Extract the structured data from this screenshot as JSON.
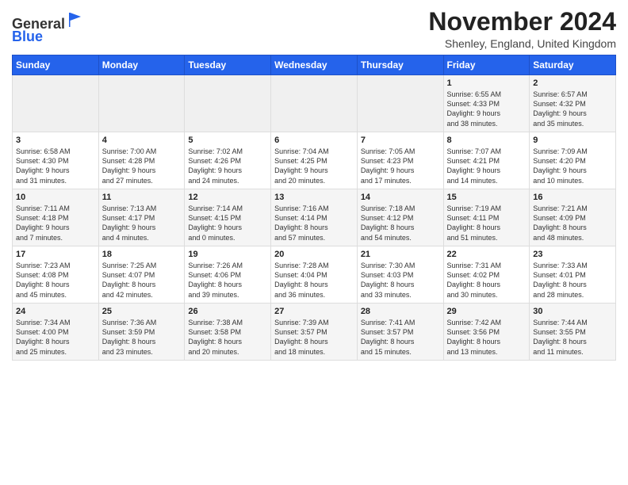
{
  "header": {
    "logo_general": "General",
    "logo_blue": "Blue",
    "title": "November 2024",
    "location": "Shenley, England, United Kingdom"
  },
  "weekdays": [
    "Sunday",
    "Monday",
    "Tuesday",
    "Wednesday",
    "Thursday",
    "Friday",
    "Saturday"
  ],
  "rows": [
    [
      {
        "day": "",
        "info": ""
      },
      {
        "day": "",
        "info": ""
      },
      {
        "day": "",
        "info": ""
      },
      {
        "day": "",
        "info": ""
      },
      {
        "day": "",
        "info": ""
      },
      {
        "day": "1",
        "info": "Sunrise: 6:55 AM\nSunset: 4:33 PM\nDaylight: 9 hours\nand 38 minutes."
      },
      {
        "day": "2",
        "info": "Sunrise: 6:57 AM\nSunset: 4:32 PM\nDaylight: 9 hours\nand 35 minutes."
      }
    ],
    [
      {
        "day": "3",
        "info": "Sunrise: 6:58 AM\nSunset: 4:30 PM\nDaylight: 9 hours\nand 31 minutes."
      },
      {
        "day": "4",
        "info": "Sunrise: 7:00 AM\nSunset: 4:28 PM\nDaylight: 9 hours\nand 27 minutes."
      },
      {
        "day": "5",
        "info": "Sunrise: 7:02 AM\nSunset: 4:26 PM\nDaylight: 9 hours\nand 24 minutes."
      },
      {
        "day": "6",
        "info": "Sunrise: 7:04 AM\nSunset: 4:25 PM\nDaylight: 9 hours\nand 20 minutes."
      },
      {
        "day": "7",
        "info": "Sunrise: 7:05 AM\nSunset: 4:23 PM\nDaylight: 9 hours\nand 17 minutes."
      },
      {
        "day": "8",
        "info": "Sunrise: 7:07 AM\nSunset: 4:21 PM\nDaylight: 9 hours\nand 14 minutes."
      },
      {
        "day": "9",
        "info": "Sunrise: 7:09 AM\nSunset: 4:20 PM\nDaylight: 9 hours\nand 10 minutes."
      }
    ],
    [
      {
        "day": "10",
        "info": "Sunrise: 7:11 AM\nSunset: 4:18 PM\nDaylight: 9 hours\nand 7 minutes."
      },
      {
        "day": "11",
        "info": "Sunrise: 7:13 AM\nSunset: 4:17 PM\nDaylight: 9 hours\nand 4 minutes."
      },
      {
        "day": "12",
        "info": "Sunrise: 7:14 AM\nSunset: 4:15 PM\nDaylight: 9 hours\nand 0 minutes."
      },
      {
        "day": "13",
        "info": "Sunrise: 7:16 AM\nSunset: 4:14 PM\nDaylight: 8 hours\nand 57 minutes."
      },
      {
        "day": "14",
        "info": "Sunrise: 7:18 AM\nSunset: 4:12 PM\nDaylight: 8 hours\nand 54 minutes."
      },
      {
        "day": "15",
        "info": "Sunrise: 7:19 AM\nSunset: 4:11 PM\nDaylight: 8 hours\nand 51 minutes."
      },
      {
        "day": "16",
        "info": "Sunrise: 7:21 AM\nSunset: 4:09 PM\nDaylight: 8 hours\nand 48 minutes."
      }
    ],
    [
      {
        "day": "17",
        "info": "Sunrise: 7:23 AM\nSunset: 4:08 PM\nDaylight: 8 hours\nand 45 minutes."
      },
      {
        "day": "18",
        "info": "Sunrise: 7:25 AM\nSunset: 4:07 PM\nDaylight: 8 hours\nand 42 minutes."
      },
      {
        "day": "19",
        "info": "Sunrise: 7:26 AM\nSunset: 4:06 PM\nDaylight: 8 hours\nand 39 minutes."
      },
      {
        "day": "20",
        "info": "Sunrise: 7:28 AM\nSunset: 4:04 PM\nDaylight: 8 hours\nand 36 minutes."
      },
      {
        "day": "21",
        "info": "Sunrise: 7:30 AM\nSunset: 4:03 PM\nDaylight: 8 hours\nand 33 minutes."
      },
      {
        "day": "22",
        "info": "Sunrise: 7:31 AM\nSunset: 4:02 PM\nDaylight: 8 hours\nand 30 minutes."
      },
      {
        "day": "23",
        "info": "Sunrise: 7:33 AM\nSunset: 4:01 PM\nDaylight: 8 hours\nand 28 minutes."
      }
    ],
    [
      {
        "day": "24",
        "info": "Sunrise: 7:34 AM\nSunset: 4:00 PM\nDaylight: 8 hours\nand 25 minutes."
      },
      {
        "day": "25",
        "info": "Sunrise: 7:36 AM\nSunset: 3:59 PM\nDaylight: 8 hours\nand 23 minutes."
      },
      {
        "day": "26",
        "info": "Sunrise: 7:38 AM\nSunset: 3:58 PM\nDaylight: 8 hours\nand 20 minutes."
      },
      {
        "day": "27",
        "info": "Sunrise: 7:39 AM\nSunset: 3:57 PM\nDaylight: 8 hours\nand 18 minutes."
      },
      {
        "day": "28",
        "info": "Sunrise: 7:41 AM\nSunset: 3:57 PM\nDaylight: 8 hours\nand 15 minutes."
      },
      {
        "day": "29",
        "info": "Sunrise: 7:42 AM\nSunset: 3:56 PM\nDaylight: 8 hours\nand 13 minutes."
      },
      {
        "day": "30",
        "info": "Sunrise: 7:44 AM\nSunset: 3:55 PM\nDaylight: 8 hours\nand 11 minutes."
      }
    ]
  ]
}
